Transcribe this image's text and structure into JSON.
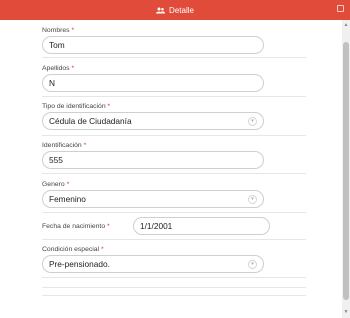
{
  "header": {
    "title": "Detalle",
    "icon": "users-icon"
  },
  "form": {
    "nombres": {
      "label": "Nombres",
      "required": "*",
      "value": "Tom"
    },
    "apellidos": {
      "label": "Apellidos",
      "required": "*",
      "value": "N"
    },
    "tipo_id": {
      "label": "Tipo de identificación",
      "required": "*",
      "value": "Cédula de Ciudadanía"
    },
    "identificacion": {
      "label": "Identificación",
      "required": "*",
      "value": "555"
    },
    "genero": {
      "label": "Genero",
      "required": "*",
      "value": "Femenino"
    },
    "fecha_nacimiento": {
      "label": "Fecha de nacimiento",
      "required": "*",
      "value": "1/1/2001"
    },
    "condicion_especial": {
      "label": "Condición especial",
      "required": "*",
      "value": "Pre-pensionado."
    }
  },
  "colors": {
    "header_bg": "#e14c3a",
    "required": "#c0392b"
  }
}
